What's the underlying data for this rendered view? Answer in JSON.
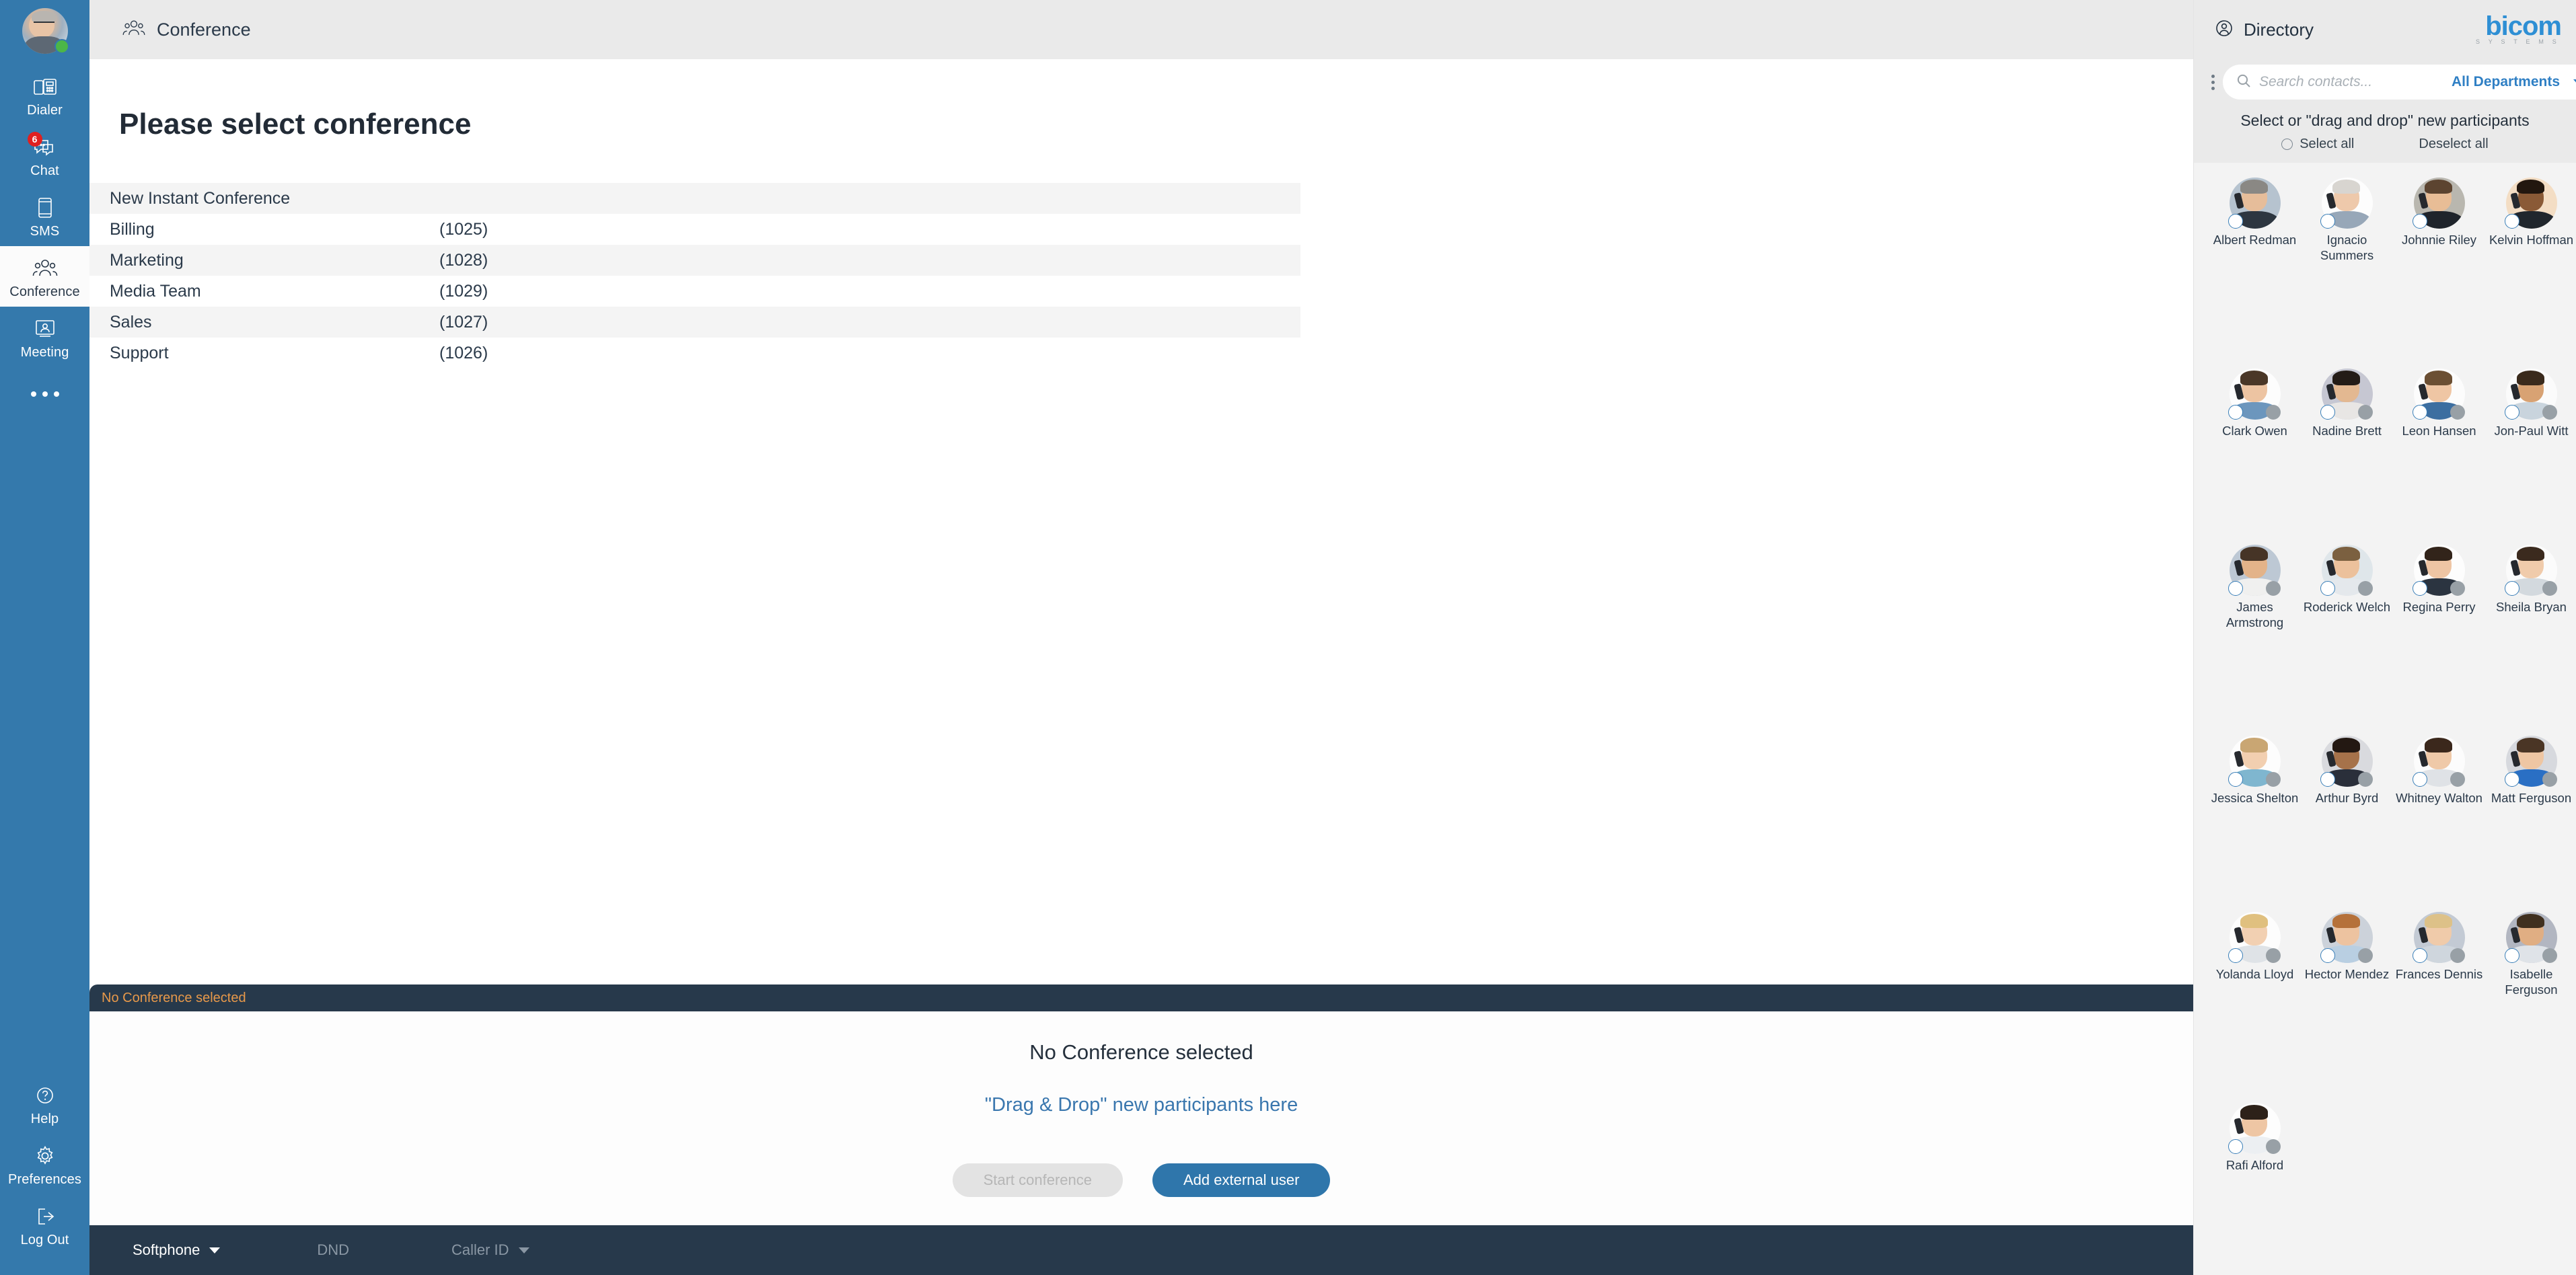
{
  "sidebar": {
    "avatar": {
      "icon": "user-avatar",
      "presence": "online",
      "presence_color": "#4cb648"
    },
    "items": [
      {
        "label": "Dialer",
        "icon": "desk-phone-icon",
        "active": false,
        "badge": null
      },
      {
        "label": "Chat",
        "icon": "chat-bubble-icon",
        "active": false,
        "badge": "6"
      },
      {
        "label": "SMS",
        "icon": "mobile-phone-icon",
        "active": false,
        "badge": null
      },
      {
        "label": "Conference",
        "icon": "people-group-icon",
        "active": true,
        "badge": null
      },
      {
        "label": "Meeting",
        "icon": "screen-person-icon",
        "active": false,
        "badge": null
      }
    ],
    "more_label": "more-options",
    "bottom_items": [
      {
        "label": "Help",
        "icon": "question-circle-icon"
      },
      {
        "label": "Preferences",
        "icon": "gear-icon"
      },
      {
        "label": "Log Out",
        "icon": "logout-arrow-icon"
      }
    ],
    "bg_color": "#3479ac"
  },
  "topbar": {
    "title": "Conference",
    "icon": "people-group-icon"
  },
  "main": {
    "page_title": "Please select conference",
    "columns": [
      "name",
      "extension"
    ],
    "rows": [
      {
        "name": "New Instant Conference",
        "extension": ""
      },
      {
        "name": "Billing",
        "extension": "(1025)"
      },
      {
        "name": "Marketing",
        "extension": "(1028)"
      },
      {
        "name": "Media Team",
        "extension": "(1029)"
      },
      {
        "name": "Sales",
        "extension": "(1027)"
      },
      {
        "name": "Support",
        "extension": "(1026)"
      }
    ]
  },
  "conference_panel": {
    "header_status": "No Conference selected",
    "header_status_color": "#e8994a",
    "title": "No Conference selected",
    "subtitle": "\"Drag & Drop\" new participants here",
    "subtitle_color": "#3a77ae",
    "start_button": "Start conference",
    "start_button_enabled": false,
    "add_button": "Add external user",
    "add_button_color": "#2f76ab"
  },
  "statusbar": {
    "softphone_label": "Softphone",
    "dnd_label": "DND",
    "caller_id_label": "Caller ID",
    "bg_color": "#27394b"
  },
  "directory": {
    "title": "Directory",
    "title_icon": "person-circle-icon",
    "logo_main": "bicom",
    "logo_sub": "S Y S T E M S",
    "logo_color": "#2e8fd4",
    "kebab_icon": "more-vertical-icon",
    "search": {
      "placeholder": "Search contacts...",
      "value": "",
      "icon": "search-icon"
    },
    "department_filter": {
      "label": "All Departments",
      "icon": "chevron-down-icon"
    },
    "expand_icon": "chevron-right-icon",
    "hint": "Select or \"drag and drop\" new participants",
    "select_all": "Select all",
    "deselect_all": "Deselect all",
    "contacts": [
      {
        "name": "Albert Redman",
        "selected": false,
        "presence": null,
        "skin": "#e6bd9a",
        "hair": "#8a8884",
        "bg": "#b6c3cf",
        "body": "#2d3640"
      },
      {
        "name": "Ignacio Summers",
        "selected": false,
        "presence": null,
        "skin": "#eec9ab",
        "hair": "#d8d5d0",
        "bg": "#fdfdfd",
        "body": "#97a7b8"
      },
      {
        "name": "Johnnie Riley",
        "selected": false,
        "presence": null,
        "skin": "#e8bd96",
        "hair": "#5c4430",
        "bg": "#b9b7af",
        "body": "#1f242b"
      },
      {
        "name": "Kelvin Hoffman",
        "selected": false,
        "presence": null,
        "skin": "#8a5a36",
        "hair": "#22170f",
        "bg": "#f3ddc4",
        "body": "#20262d"
      },
      {
        "name": "Clark Owen",
        "selected": false,
        "presence": "offline",
        "skin": "#edc4a2",
        "hair": "#4a3727",
        "bg": "#fdfdfd",
        "body": "#6c96bd"
      },
      {
        "name": "Nadine Brett",
        "selected": false,
        "presence": "offline",
        "skin": "#e3b891",
        "hair": "#241c17",
        "bg": "#c6c7d2",
        "body": "#e8e6e4"
      },
      {
        "name": "Leon Hansen",
        "selected": false,
        "presence": "offline",
        "skin": "#efc6a4",
        "hair": "#6b4f33",
        "bg": "#fcfcfc",
        "body": "#3c6ea0"
      },
      {
        "name": "Jon-Paul Witt",
        "selected": false,
        "presence": "offline",
        "skin": "#d8a273",
        "hair": "#3a2a1c",
        "bg": "#fbfbfb",
        "body": "#c9d4dd"
      },
      {
        "name": "James Armstrong",
        "selected": false,
        "presence": "offline",
        "skin": "#e3b389",
        "hair": "#463426",
        "bg": "#bdc8d4",
        "body": "#f0f0ef"
      },
      {
        "name": "Roderick Welch",
        "selected": false,
        "presence": "offline",
        "skin": "#ecc19c",
        "hair": "#7b6040",
        "bg": "#dfe6ea",
        "body": "#e4e8ec"
      },
      {
        "name": "Regina Perry",
        "selected": false,
        "presence": "offline",
        "skin": "#eec5a4",
        "hair": "#32241a",
        "bg": "#fdfdfd",
        "body": "#2b3440"
      },
      {
        "name": "Sheila Bryan",
        "selected": false,
        "presence": "offline",
        "skin": "#f0cbab",
        "hair": "#3b2a1e",
        "bg": "#fbfbfb",
        "body": "#d3d9de"
      },
      {
        "name": "Jessica Shelton",
        "selected": false,
        "presence": "offline",
        "skin": "#f2cfb0",
        "hair": "#c9a673",
        "bg": "#fdfdfd",
        "body": "#7fb6cf"
      },
      {
        "name": "Arthur Byrd",
        "selected": false,
        "presence": "offline",
        "skin": "#a6724a",
        "hair": "#231812",
        "bg": "#d9dade",
        "body": "#2a2f3a"
      },
      {
        "name": "Whitney Walton",
        "selected": false,
        "presence": "offline",
        "skin": "#efc9a8",
        "hair": "#3b281c",
        "bg": "#fcfcfc",
        "body": "#dfe2e6"
      },
      {
        "name": "Matt Ferguson",
        "selected": false,
        "presence": "offline",
        "skin": "#eec6a3",
        "hair": "#4a3525",
        "bg": "#d7d9de",
        "body": "#2a6fc4"
      },
      {
        "name": "Yolanda Lloyd",
        "selected": false,
        "presence": "offline",
        "skin": "#f2d0b2",
        "hair": "#e0c07f",
        "bg": "#fdfdfd",
        "body": "#dfe3e7"
      },
      {
        "name": "Hector Mendez",
        "selected": false,
        "presence": "offline",
        "skin": "#edc3a0",
        "hair": "#b5713a",
        "bg": "#ccd2da",
        "body": "#b9cfe2"
      },
      {
        "name": "Frances Dennis",
        "selected": false,
        "presence": "offline",
        "skin": "#f0cbaa",
        "hair": "#ddc188",
        "bg": "#c3cad4",
        "body": "#cfd6dd"
      },
      {
        "name": "Isabelle Ferguson",
        "selected": false,
        "presence": "offline",
        "skin": "#e0ae83",
        "hair": "#40301f",
        "bg": "#b2b6c1",
        "body": "#dfe3e8"
      },
      {
        "name": "Rafi Alford",
        "selected": false,
        "presence": "offline",
        "skin": "#eec6a4",
        "hair": "#2d2119",
        "bg": "#fdfdfd",
        "body": "#eceff2"
      }
    ]
  }
}
